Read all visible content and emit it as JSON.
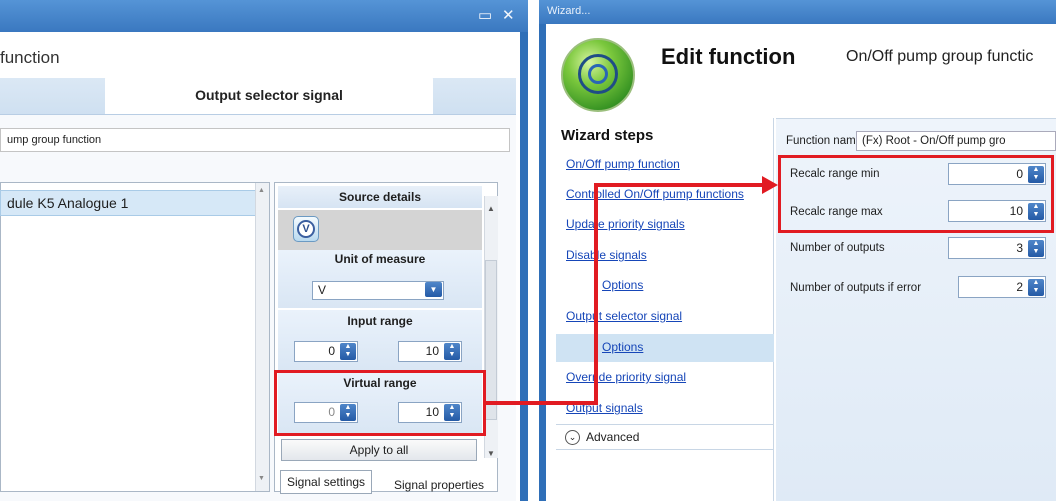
{
  "left_window": {
    "header_text": "function",
    "tab_label": "Output selector signal",
    "function_name_value": "ump group function",
    "list_items": [
      "dule K5 Analogue 1"
    ],
    "details": {
      "source_details_label": "Source details",
      "source_icon_letter": "V",
      "unit_label": "Unit of measure",
      "unit_value": "V",
      "input_range_label": "Input range",
      "input_min": "0",
      "input_max": "10",
      "virtual_range_label": "Virtual range",
      "virtual_min": "0",
      "virtual_max": "10",
      "apply_label": "Apply to all"
    },
    "bottom_tabs": [
      "Signal settings",
      "Signal properties"
    ]
  },
  "right_window": {
    "title": "Wizard...",
    "heading": "Edit function",
    "subheading": "On/Off pump group functic",
    "steps_heading": "Wizard steps",
    "steps": [
      "On/Off pump function",
      "Controlled On/Off pump functions",
      "Update priority signals",
      "Disable signals",
      "Options",
      "Output selector signal",
      "Options",
      "Override priority signal",
      "Output signals"
    ],
    "advanced_label": "Advanced",
    "function_name_label": "Function name:",
    "function_name_value": "(Fx) Root - On/Off pump gro",
    "fields": [
      {
        "label": "Recalc range min",
        "value": "0"
      },
      {
        "label": "Recalc range max",
        "value": "10"
      },
      {
        "label": "Number of outputs",
        "value": "3"
      },
      {
        "label": "Number of outputs if error",
        "value": "2"
      }
    ]
  },
  "colors": {
    "highlight": "#e11b22",
    "window_frame": "#2f6fb8",
    "link": "#1646b8"
  }
}
